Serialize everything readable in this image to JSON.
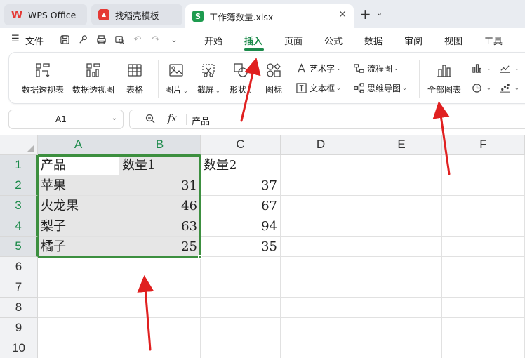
{
  "tabs": {
    "wps": "WPS Office",
    "daoke": "找稻壳模板",
    "file": "工作簿数量.xlsx",
    "file_logo": "S"
  },
  "menu": {
    "file_label": "文件",
    "items": [
      "开始",
      "插入",
      "页面",
      "公式",
      "数据",
      "审阅",
      "视图",
      "工具"
    ],
    "active": "插入"
  },
  "ribbon": {
    "pivot_table": "数据透视表",
    "pivot_chart": "数据透视图",
    "table": "表格",
    "picture": "图片",
    "screenshot": "截屏",
    "shape": "形状",
    "icon": "图标",
    "wordart": "艺术字",
    "textbox": "文本框",
    "flowchart": "流程图",
    "mindmap": "思维导图",
    "all_charts": "全部图表"
  },
  "formula_bar": {
    "name_box": "A1",
    "fx": "fx",
    "content": "产品"
  },
  "grid": {
    "columns": [
      "A",
      "B",
      "C",
      "D",
      "E",
      "F"
    ],
    "rows": [
      "1",
      "2",
      "3",
      "4",
      "5",
      "6",
      "7",
      "8",
      "9",
      "10"
    ],
    "cells": {
      "A1": "产品",
      "B1": "数量1",
      "C1": "数量2",
      "A2": "苹果",
      "B2": "31",
      "C2": "37",
      "A3": "火龙果",
      "B3": "46",
      "C3": "67",
      "A4": "梨子",
      "B4": "63",
      "C4": "94",
      "A5": "橘子",
      "B5": "25",
      "C5": "35"
    }
  },
  "colors": {
    "accent_green": "#1b8a4a",
    "selection_border": "#3c8f3f",
    "annotation_red": "#e02020"
  }
}
